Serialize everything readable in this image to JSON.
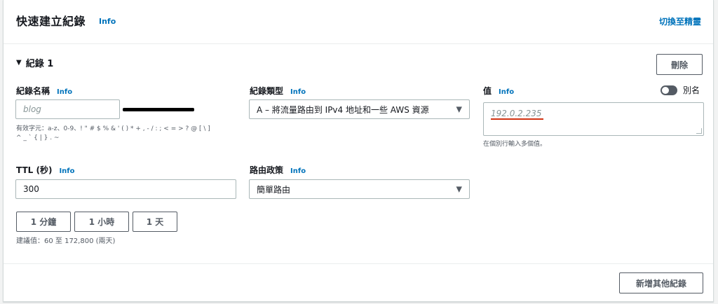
{
  "header": {
    "title": "快速建立紀錄",
    "info": "Info",
    "switch_link": "切換至精靈"
  },
  "record": {
    "heading": "紀錄 1",
    "delete_label": "刪除"
  },
  "record_name": {
    "label": "紀錄名稱",
    "info": "Info",
    "placeholder": "blog",
    "hint_line1": "有效字元：a-z、0-9、! \" # $ % & ' ( ) * + , - / : ; < = > ? @ [ \\ ]",
    "hint_line2": "^ _ ` { | } . ~"
  },
  "record_type": {
    "label": "紀錄類型",
    "info": "Info",
    "selected": "A – 將流量路由到 IPv4 地址和一些 AWS 資源"
  },
  "value": {
    "label": "值",
    "info": "Info",
    "placeholder": "192.0.2.235",
    "hint": "在個別行輸入多個值。",
    "alias_label": "別名",
    "alias_enabled": false
  },
  "ttl": {
    "label": "TTL (秒)",
    "info": "Info",
    "value": "300",
    "quick_buttons": [
      "1 分鐘",
      "1 小時",
      "1 天"
    ],
    "hint": "建議值：60 至 172,800 (兩天)"
  },
  "routing_policy": {
    "label": "路由政策",
    "info": "Info",
    "selected": "簡單路由"
  },
  "footer": {
    "add_label": "新增其他紀錄"
  },
  "icons": {
    "expand": "caret-down-icon",
    "dropdown": "triangle-down-icon"
  }
}
